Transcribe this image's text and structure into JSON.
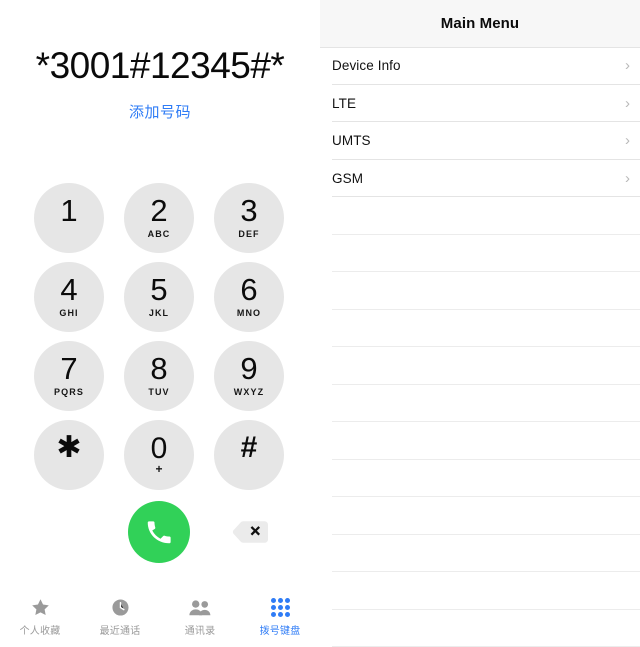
{
  "dialer": {
    "number": "*3001#12345#*",
    "add_number_label": "添加号码",
    "keys": [
      {
        "digit": "1",
        "letters": ""
      },
      {
        "digit": "2",
        "letters": "ABC"
      },
      {
        "digit": "3",
        "letters": "DEF"
      },
      {
        "digit": "4",
        "letters": "GHI"
      },
      {
        "digit": "5",
        "letters": "JKL"
      },
      {
        "digit": "6",
        "letters": "MNO"
      },
      {
        "digit": "7",
        "letters": "PQRS"
      },
      {
        "digit": "8",
        "letters": "TUV"
      },
      {
        "digit": "9",
        "letters": "WXYZ"
      },
      {
        "digit": "✱",
        "letters": ""
      },
      {
        "digit": "0",
        "letters": "+"
      },
      {
        "digit": "#",
        "letters": ""
      }
    ],
    "call_button_icon": "phone-handset-icon",
    "delete_button_icon": "backspace-icon",
    "colors": {
      "call_green": "#31d158",
      "key_gray": "#e6e6e6",
      "link_blue": "#2f7cf6"
    }
  },
  "tabbar": {
    "items": [
      {
        "label": "个人收藏",
        "icon": "star-icon",
        "active": false
      },
      {
        "label": "最近通话",
        "icon": "clock-icon",
        "active": false
      },
      {
        "label": "通讯录",
        "icon": "contacts-icon",
        "active": false
      },
      {
        "label": "拨号键盘",
        "icon": "keypad-icon",
        "active": true
      }
    ],
    "active_color": "#2f7cf6",
    "inactive_color": "#9a9a9a"
  },
  "menu_panel": {
    "header_title": "Main Menu",
    "rows": [
      {
        "label": "Device Info",
        "chevron": "›"
      },
      {
        "label": "LTE",
        "chevron": "›"
      },
      {
        "label": "UMTS",
        "chevron": "›"
      },
      {
        "label": "GSM",
        "chevron": "›"
      }
    ],
    "empty_row_count": 12
  }
}
